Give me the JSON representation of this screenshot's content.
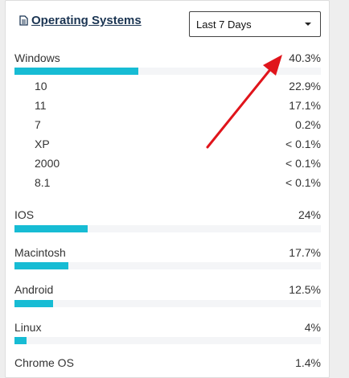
{
  "header": {
    "title": "Operating Systems",
    "icon": "document-icon",
    "range_select": {
      "value": "Last 7 Days"
    }
  },
  "colors": {
    "bar": "#17bcd4",
    "track": "#f4f5f7",
    "title": "#1b3553",
    "arrow": "#e0141b"
  },
  "os": [
    {
      "label": "Windows",
      "value": "40.3%",
      "share": 40.3,
      "versions": [
        {
          "label": "10",
          "value": "22.9%"
        },
        {
          "label": "11",
          "value": "17.1%"
        },
        {
          "label": "7",
          "value": "0.2%"
        },
        {
          "label": "XP",
          "value": "< 0.1%"
        },
        {
          "label": "2000",
          "value": "< 0.1%"
        },
        {
          "label": "8.1",
          "value": "< 0.1%"
        }
      ]
    },
    {
      "label": "IOS",
      "value": "24%",
      "share": 24
    },
    {
      "label": "Macintosh",
      "value": "17.7%",
      "share": 17.7
    },
    {
      "label": "Android",
      "value": "12.5%",
      "share": 12.5
    },
    {
      "label": "Linux",
      "value": "4%",
      "share": 4
    },
    {
      "label": "Chrome OS",
      "value": "1.4%",
      "share": 1.4
    }
  ]
}
